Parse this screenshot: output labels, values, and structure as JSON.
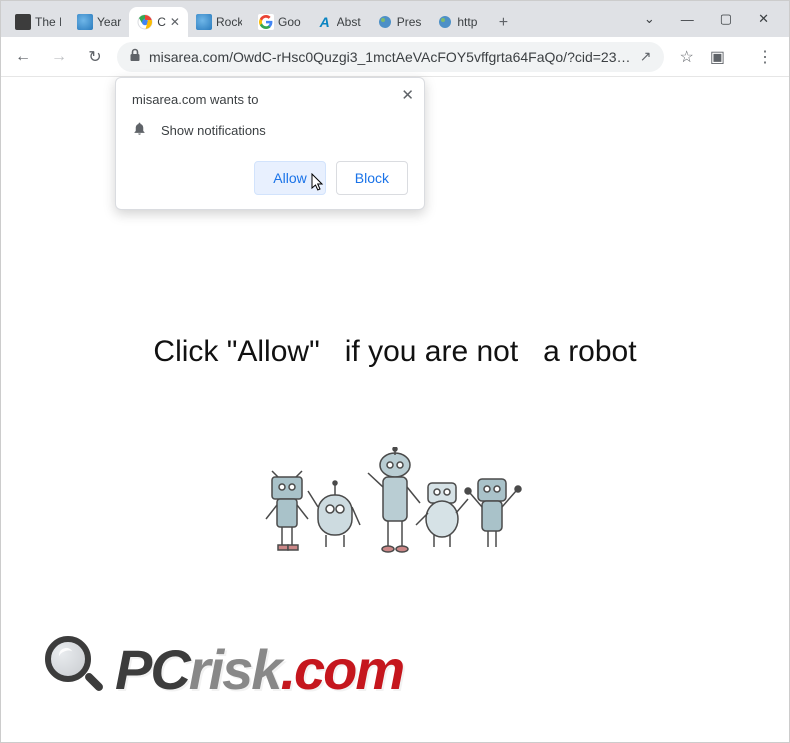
{
  "window_controls": {
    "min": "—",
    "max": "▢",
    "close": "✕",
    "dropdown": "⌄"
  },
  "tabs": [
    {
      "title": "The I",
      "favicon_name": "generic-dark-icon"
    },
    {
      "title": "Year",
      "favicon_name": "earth-icon"
    },
    {
      "title": "C",
      "favicon_name": "chrome-icon",
      "active": true
    },
    {
      "title": "Rock",
      "favicon_name": "earth-icon"
    },
    {
      "title": "Goo",
      "favicon_name": "google-g-icon"
    },
    {
      "title": "Abst",
      "favicon_name": "azure-a-icon"
    },
    {
      "title": "Pres",
      "favicon_name": "earth-small-icon"
    },
    {
      "title": "http",
      "favicon_name": "earth-small-icon"
    }
  ],
  "newtab_label": "+",
  "toolbar": {
    "back": "←",
    "forward": "→",
    "reload": "↻",
    "url": "misarea.com/OwdC-rHsc0Quzgi3_1mctAeVAcFOY5vffgrta64FaQo/?cid=235…",
    "share": "↗",
    "star": "☆",
    "ext": "▣",
    "menu": "⋮"
  },
  "permission": {
    "headline": "misarea.com wants to",
    "item": "Show notifications",
    "allow": "Allow",
    "block": "Block",
    "close": "✕"
  },
  "page": {
    "headline": "Click \"Allow\"   if you are not   a robot"
  },
  "logo": {
    "pc": "PC",
    "risk": "risk",
    "dotcom": ".com"
  }
}
